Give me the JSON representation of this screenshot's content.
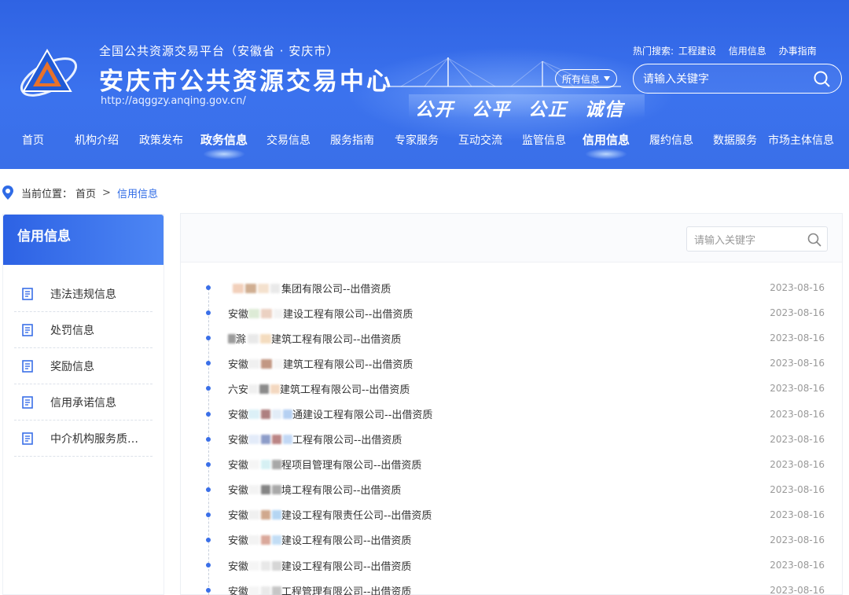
{
  "header": {
    "platform_subtitle": "全国公共资源交易平台（安徽省 · 安庆市）",
    "site_title": "安庆市公共资源交易中心",
    "site_url": "http://aqggzy.anqing.gov.cn/",
    "slogan": [
      "公开",
      "公平",
      "公正",
      "诚信"
    ],
    "hot_search_label": "热门搜索:",
    "hot_search_items": [
      "工程建设",
      "信用信息",
      "办事指南"
    ],
    "search_scope": "所有信息",
    "search_placeholder": "请输入关键字"
  },
  "nav": {
    "items": [
      "首页",
      "机构介绍",
      "政策发布",
      "政务信息",
      "交易信息",
      "服务指南",
      "专家服务",
      "互动交流",
      "监管信息",
      "信用信息",
      "履约信息",
      "数据服务",
      "市场主体信息"
    ],
    "active": [
      "政务信息",
      "信用信息"
    ]
  },
  "breadcrumb": {
    "label": "当前位置：",
    "home": "首页",
    "separator": ">",
    "current": "信用信息"
  },
  "sidebar": {
    "title": "信用信息",
    "items": [
      "违法违规信息",
      "处罚信息",
      "奖励信息",
      "信用承诺信息",
      "中介机构服务质…"
    ]
  },
  "list": {
    "search_placeholder": "请输入关键字",
    "rows": [
      {
        "prefix": "",
        "title": "集团有限公司--出借资质",
        "date": "2023-08-16"
      },
      {
        "prefix": "安徽",
        "title": "建设工程有限公司--出借资质",
        "date": "2023-08-16"
      },
      {
        "prefix": "滁",
        "title": "建筑工程有限公司--出借资质",
        "date": "2023-08-16"
      },
      {
        "prefix": "安徽",
        "title": "建筑工程有限公司--出借资质",
        "date": "2023-08-16"
      },
      {
        "prefix": "六安",
        "title": "建筑工程有限公司--出借资质",
        "date": "2023-08-16"
      },
      {
        "prefix": "安徽",
        "title": "通建设工程有限公司--出借资质",
        "date": "2023-08-16"
      },
      {
        "prefix": "安徽",
        "title": "工程有限公司--出借资质",
        "date": "2023-08-16"
      },
      {
        "prefix": "安徽",
        "title": "程项目管理有限公司--出借资质",
        "date": "2023-08-16"
      },
      {
        "prefix": "安徽",
        "title": "境工程有限公司--出借资质",
        "date": "2023-08-16"
      },
      {
        "prefix": "安徽",
        "title": "建设工程有限责任公司--出借资质",
        "date": "2023-08-16"
      },
      {
        "prefix": "安徽",
        "title": "建设工程有限公司--出借资质",
        "date": "2023-08-16"
      },
      {
        "prefix": "安徽",
        "title": "建设工程有限公司--出借资质",
        "date": "2023-08-16"
      },
      {
        "prefix": "安徽",
        "title": "工程管理有限公司--出借资质",
        "date": "2023-08-16"
      }
    ]
  },
  "colors": {
    "brand_blue": "#3a6fe8",
    "header_bg": "#2f63e3",
    "link_blue": "#2f6be6"
  }
}
